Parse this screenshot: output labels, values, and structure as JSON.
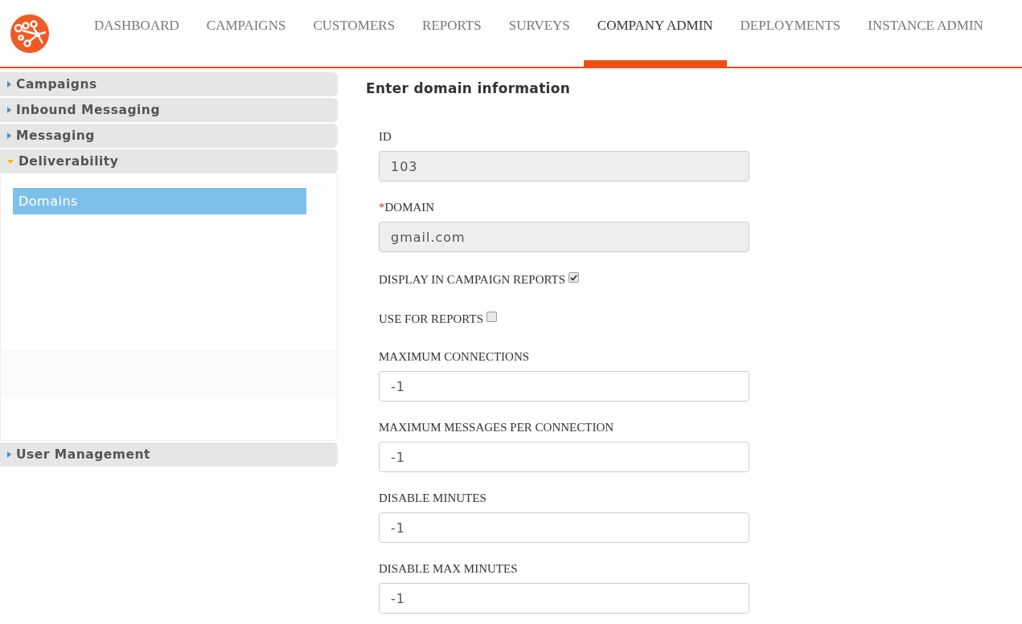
{
  "nav": {
    "tabs": [
      {
        "label": "DASHBOARD",
        "selected": false
      },
      {
        "label": "CAMPAIGNS",
        "selected": false
      },
      {
        "label": "CUSTOMERS",
        "selected": false
      },
      {
        "label": "REPORTS",
        "selected": false
      },
      {
        "label": "SURVEYS",
        "selected": false
      },
      {
        "label": "COMPANY ADMIN",
        "selected": true
      },
      {
        "label": "DEPLOYMENTS",
        "selected": false
      },
      {
        "label": "INSTANCE ADMIN",
        "selected": false
      }
    ]
  },
  "sidebar": {
    "sections": [
      {
        "label": "Campaigns",
        "expanded": false
      },
      {
        "label": "Inbound Messaging",
        "expanded": false
      },
      {
        "label": "Messaging",
        "expanded": false
      },
      {
        "label": "Deliverability",
        "expanded": true,
        "children": [
          {
            "label": "Domains",
            "selected": true
          }
        ]
      },
      {
        "label": "User Management",
        "expanded": false
      }
    ]
  },
  "form": {
    "title": "Enter domain information",
    "fields": [
      {
        "kind": "text",
        "label": "ID",
        "value": "103",
        "disabled": true
      },
      {
        "kind": "text",
        "required_marker": "*",
        "label": "DOMAIN",
        "value": "gmail.com",
        "disabled": true
      },
      {
        "kind": "checkbox",
        "label": "DISPLAY IN CAMPAIGN REPORTS",
        "checked": true
      },
      {
        "kind": "checkbox",
        "label": "USE FOR REPORTS",
        "checked": false
      },
      {
        "kind": "text",
        "label": "MAXIMUM CONNECTIONS",
        "value": "-1",
        "disabled": false
      },
      {
        "kind": "text",
        "label": "MAXIMUM MESSAGES PER CONNECTION",
        "value": "-1",
        "disabled": false
      },
      {
        "kind": "text",
        "label": "DISABLE MINUTES",
        "value": "-1",
        "disabled": false
      },
      {
        "kind": "text",
        "label": "DISABLE MAX MINUTES",
        "value": "-1",
        "disabled": false
      }
    ]
  }
}
